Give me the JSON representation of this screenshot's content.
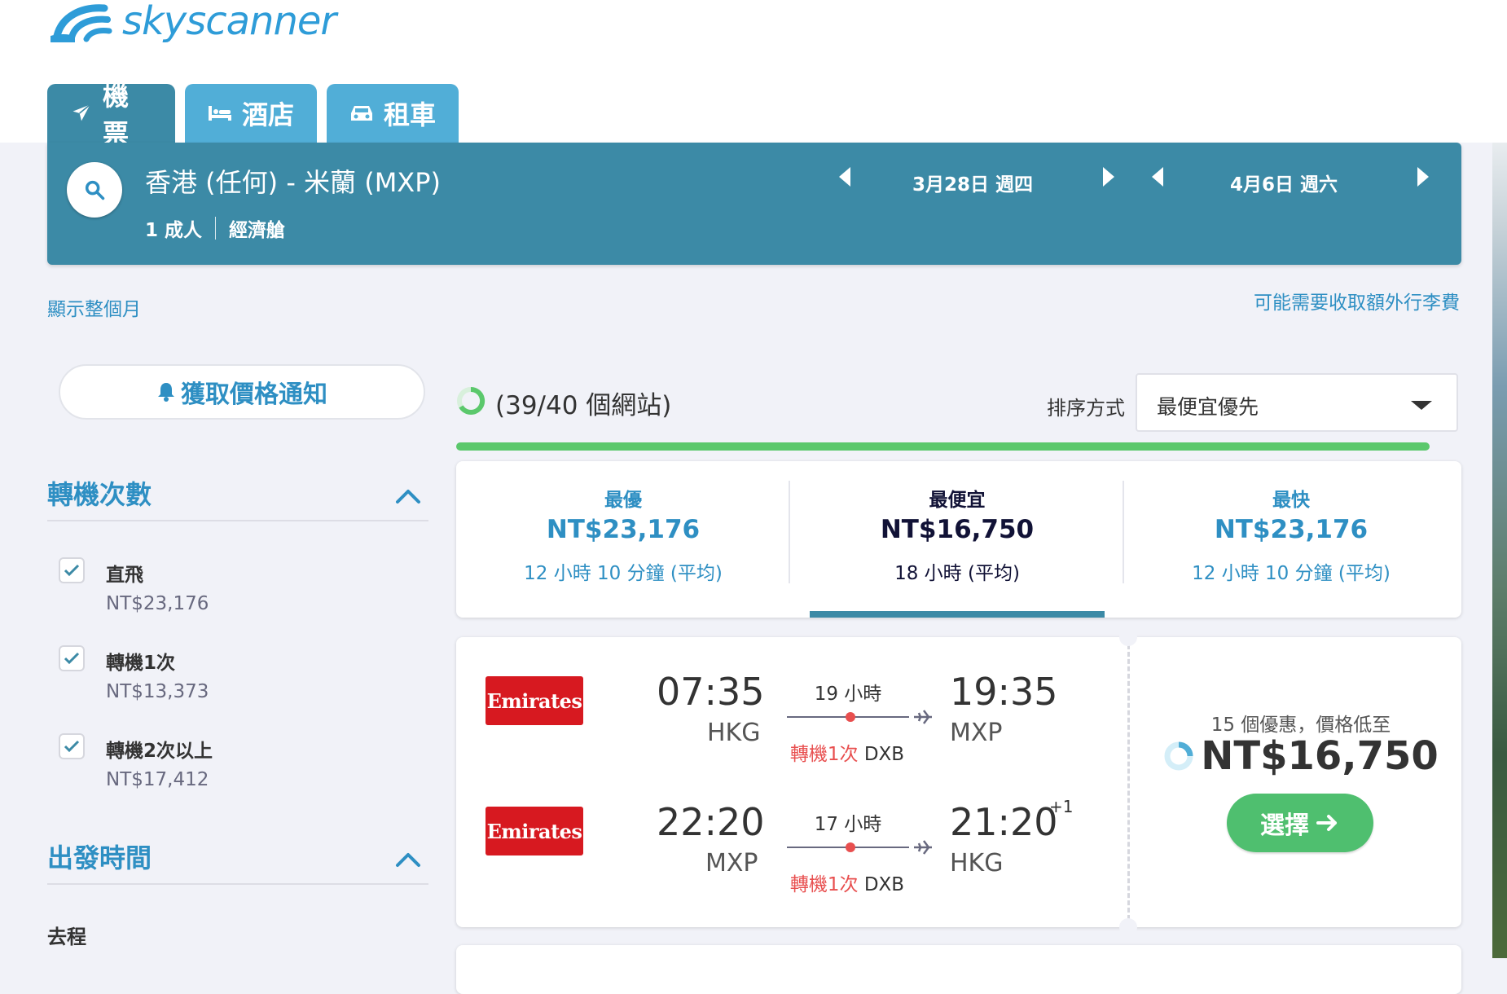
{
  "brand": {
    "name": "skyscanner"
  },
  "tabs": [
    {
      "label": "機票",
      "icon": "plane-icon",
      "active": true
    },
    {
      "label": "酒店",
      "icon": "bed-icon",
      "active": false
    },
    {
      "label": "租車",
      "icon": "car-icon",
      "active": false
    }
  ],
  "search": {
    "route": "香港 (任何) - 米蘭 (MXP)",
    "passengers": "1 成人",
    "cabin": "經濟艙",
    "depart_date": "3月28日 週四",
    "return_date": "4月6日 週六"
  },
  "links": {
    "show_month": "顯示整個月",
    "baggage_fee": "可能需要收取額外行李費"
  },
  "alert_button": "獲取價格通知",
  "filters": {
    "stops_title": "轉機次數",
    "stops": [
      {
        "label": "直飛",
        "price": "NT$23,176",
        "checked": true
      },
      {
        "label": "轉機1次",
        "price": "NT$13,373",
        "checked": true
      },
      {
        "label": "轉機2次以上",
        "price": "NT$17,412",
        "checked": true
      }
    ],
    "departure_title": "出發時間",
    "outbound_label": "去程"
  },
  "results_header": {
    "sites": "(39/40 個網站)",
    "sort_label": "排序方式",
    "sort_value": "最便宜優先",
    "progress": 0.975
  },
  "summary": [
    {
      "title": "最優",
      "price": "NT$23,176",
      "duration": "12 小時 10 分鐘 (平均)"
    },
    {
      "title": "最便宜",
      "price": "NT$16,750",
      "duration": "18 小時 (平均)"
    },
    {
      "title": "最快",
      "price": "NT$23,176",
      "duration": "12 小時 10 分鐘 (平均)"
    }
  ],
  "result": {
    "airline": "Emirates",
    "legs": [
      {
        "dep_time": "07:35",
        "dep_code": "HKG",
        "duration": "19 小時",
        "stops": "轉機1次",
        "via": "DXB",
        "arr_time": "19:35",
        "arr_code": "MXP",
        "day_offset": ""
      },
      {
        "dep_time": "22:20",
        "dep_code": "MXP",
        "duration": "17 小時",
        "stops": "轉機1次",
        "via": "DXB",
        "arr_time": "21:20",
        "arr_code": "HKG",
        "day_offset": "+1"
      }
    ],
    "deals": "15 個優惠，價格低至",
    "price": "NT$16,750",
    "select_label": "選擇"
  },
  "colors": {
    "brand_blue": "#2e9cd8",
    "bar_teal": "#3c8aa6",
    "tab_blue": "#51aed7",
    "link_blue": "#2e8fc3",
    "green": "#4fbf6f",
    "red": "#e84f4f"
  }
}
